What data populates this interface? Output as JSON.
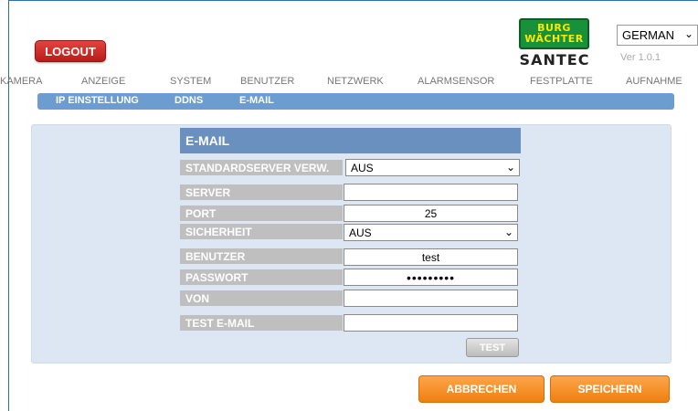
{
  "header": {
    "logout_label": "LOGOUT",
    "logo_line1": "BURG",
    "logo_line2": "WÄCHTER",
    "logo_sub": "SANTEC",
    "language": "GERMAN",
    "version": "Ver 1.0.1"
  },
  "main_nav": [
    "KAMERA",
    "ANZEIGE",
    "SYSTEM",
    "BENUTZER",
    "NETZWERK",
    "ALARMSENSOR",
    "FESTPLATTE",
    "AUFNAHME"
  ],
  "sub_nav": [
    "IP EINSTELLUNG",
    "DDNS",
    "E-MAIL"
  ],
  "form": {
    "title": "E-MAIL",
    "default_server_label": "STANDARDSERVER VERW.",
    "default_server_value": "AUS",
    "server_label": "SERVER",
    "server_value": "",
    "port_label": "PORT",
    "port_value": "25",
    "security_label": "SICHERHEIT",
    "security_value": "AUS",
    "user_label": "BENUTZER",
    "user_value": "test",
    "password_label": "PASSWORT",
    "password_value": "•••••••••",
    "from_label": "VON",
    "from_value": "",
    "test_email_label": "TEST E-MAIL",
    "test_email_value": "",
    "test_button": "TEST"
  },
  "footer": {
    "cancel_label": "ABBRECHEN",
    "save_label": "SPEICHERN"
  },
  "colors": {
    "frame": "#2b6fb7",
    "logout": "#c8282a",
    "logo_green": "#17913a",
    "logo_yellow": "#ffe600",
    "subnav": "#6d9cd0",
    "form_header": "#6a90c0",
    "label_bg": "#bfbfbf",
    "panel_bg": "#dde7f3",
    "orange": "#f28a1e"
  }
}
